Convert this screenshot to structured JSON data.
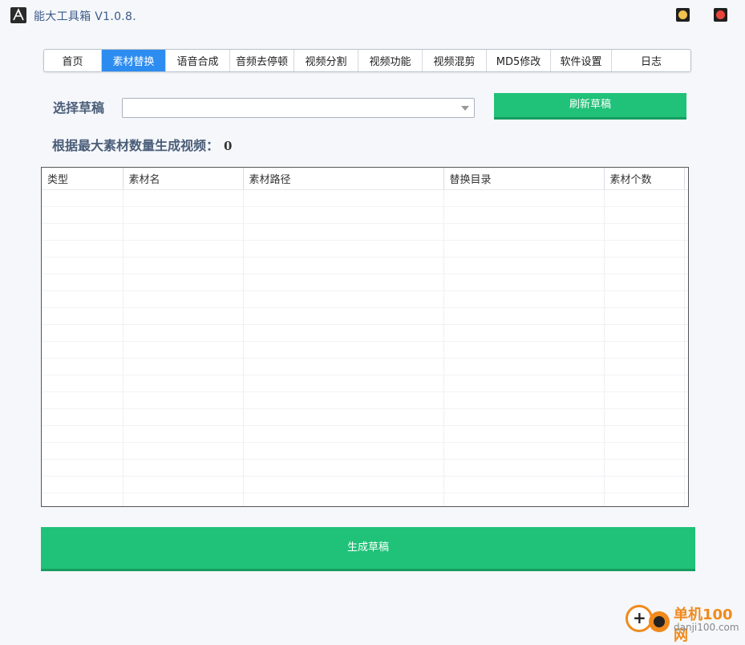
{
  "window": {
    "title": "能大工具箱 V1.0.8.",
    "logo_icon": "nengda-logo-icon",
    "minimize_color": "#f2c14e",
    "close_color": "#e8453c"
  },
  "tabs": [
    {
      "label": "首页"
    },
    {
      "label": "素材替换",
      "active": true
    },
    {
      "label": "语音合成"
    },
    {
      "label": "音频去停顿"
    },
    {
      "label": "视频分割"
    },
    {
      "label": "视频功能"
    },
    {
      "label": "视频混剪"
    },
    {
      "label": "MD5修改"
    },
    {
      "label": "软件设置"
    },
    {
      "label": "日志"
    }
  ],
  "draft": {
    "label": "选择草稿",
    "selected": "",
    "refresh_label": "刷新草稿"
  },
  "info": {
    "label": "根据最大素材数量生成视频：",
    "count": "0"
  },
  "table": {
    "columns": [
      "类型",
      "素材名",
      "素材路径",
      "替换目录",
      "素材个数"
    ],
    "rows": []
  },
  "generate_label": "生成草稿",
  "watermark": {
    "cn": "单机100网",
    "en": "danji100.com"
  },
  "colors": {
    "accent_green": "#20c178",
    "active_tab": "#2d8cf0"
  }
}
